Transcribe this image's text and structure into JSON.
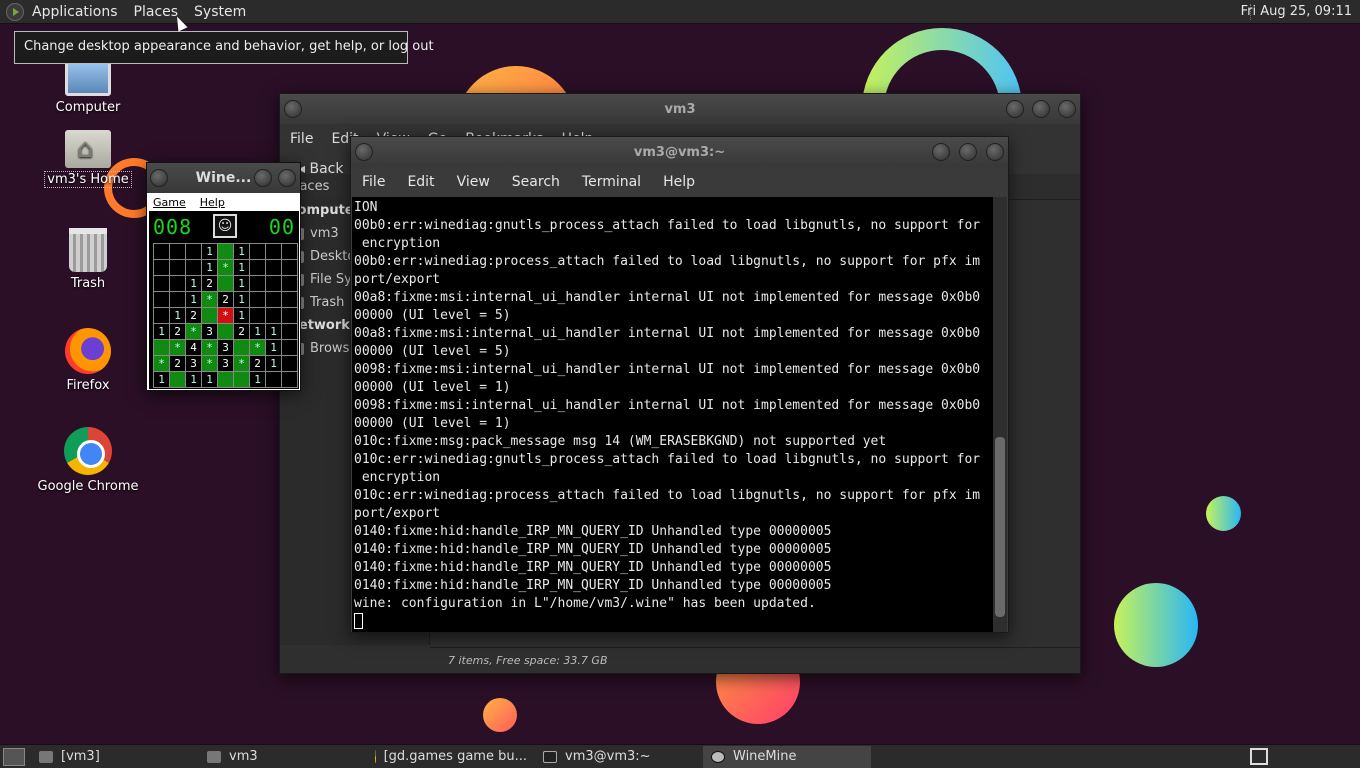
{
  "top_panel": {
    "menus": [
      "Applications",
      "Places",
      "System"
    ],
    "clock": "Fri Aug 25, 09:11"
  },
  "tooltip": "Change desktop appearance and behavior, get help, or log out",
  "desktop_icons": [
    {
      "label": "Computer",
      "icon": "computer-icon"
    },
    {
      "label": "vm3's Home",
      "icon": "home-folder-icon"
    },
    {
      "label": "Trash",
      "icon": "trash-icon"
    },
    {
      "label": "Firefox",
      "icon": "firefox-icon"
    },
    {
      "label": "Google Chrome",
      "icon": "chrome-icon"
    }
  ],
  "file_manager": {
    "title": "vm3",
    "menus": [
      "File",
      "Edit",
      "View",
      "Go",
      "Bookmarks",
      "Help"
    ],
    "back_label": "Back",
    "places_header": "Places",
    "computer_header": "Computer",
    "items": [
      "vm3",
      "Desktop",
      "File System",
      "Trash"
    ],
    "network_header": "Network",
    "network_items": [
      "Browse Network"
    ],
    "status": "7 items, Free space: 33.7 GB"
  },
  "terminal": {
    "title": "vm3@vm3:~",
    "menus": [
      "File",
      "Edit",
      "View",
      "Search",
      "Terminal",
      "Help"
    ],
    "lines": [
      "ION",
      "00b0:err:winediag:gnutls_process_attach failed to load libgnutls, no support for",
      " encryption",
      "00b0:err:winediag:process_attach failed to load libgnutls, no support for pfx im",
      "port/export",
      "00a8:fixme:msi:internal_ui_handler internal UI not implemented for message 0x0b0",
      "00000 (UI level = 5)",
      "00a8:fixme:msi:internal_ui_handler internal UI not implemented for message 0x0b0",
      "00000 (UI level = 5)",
      "0098:fixme:msi:internal_ui_handler internal UI not implemented for message 0x0b0",
      "00000 (UI level = 1)",
      "0098:fixme:msi:internal_ui_handler internal UI not implemented for message 0x0b0",
      "00000 (UI level = 1)",
      "010c:fixme:msg:pack_message msg 14 (WM_ERASEBKGND) not supported yet",
      "010c:err:winediag:gnutls_process_attach failed to load libgnutls, no support for",
      " encryption",
      "010c:err:winediag:process_attach failed to load libgnutls, no support for pfx im",
      "port/export",
      "0140:fixme:hid:handle_IRP_MN_QUERY_ID Unhandled type 00000005",
      "0140:fixme:hid:handle_IRP_MN_QUERY_ID Unhandled type 00000005",
      "0140:fixme:hid:handle_IRP_MN_QUERY_ID Unhandled type 00000005",
      "0140:fixme:hid:handle_IRP_MN_QUERY_ID Unhandled type 00000005",
      "wine: configuration in L\"/home/vm3/.wine\" has been updated."
    ]
  },
  "winemine": {
    "title": "Wine...",
    "menus": [
      "Game",
      "Help"
    ],
    "mines_left": "008",
    "timer": "00",
    "face": "☺",
    "grid": [
      [
        "",
        "",
        "",
        "1",
        "G",
        "1",
        "",
        "",
        ""
      ],
      [
        "",
        "",
        "",
        "1",
        "*",
        "1",
        "",
        "",
        ""
      ],
      [
        "",
        "",
        "1",
        "2",
        "G",
        "1",
        "",
        "",
        ""
      ],
      [
        "",
        "",
        "1",
        "*",
        "2",
        "1",
        "",
        "",
        ""
      ],
      [
        "",
        "1",
        "2",
        "G",
        "R",
        "1",
        "",
        "",
        ""
      ],
      [
        "1",
        "2",
        "*",
        "3",
        "G",
        "2",
        "1",
        "1",
        ""
      ],
      [
        "G",
        "*",
        "4",
        "*",
        "3",
        "G",
        "*",
        "1",
        ""
      ],
      [
        "*",
        "2",
        "3",
        "*",
        "3",
        "*",
        "2",
        "1",
        ""
      ],
      [
        "1",
        "G",
        "1",
        "1",
        "G",
        "G",
        "1",
        "",
        ""
      ]
    ]
  },
  "taskbar": {
    "tasks": [
      {
        "label": "[vm3]",
        "icon": "folder-icon",
        "active": false
      },
      {
        "label": "vm3",
        "icon": "folder-icon",
        "active": false
      },
      {
        "label": "[gd.games game bu...",
        "icon": "chrome-icon",
        "active": false
      },
      {
        "label": "vm3@vm3:~",
        "icon": "terminal-icon",
        "active": false
      },
      {
        "label": "WineMine",
        "icon": "winemine-icon",
        "active": true
      }
    ]
  }
}
